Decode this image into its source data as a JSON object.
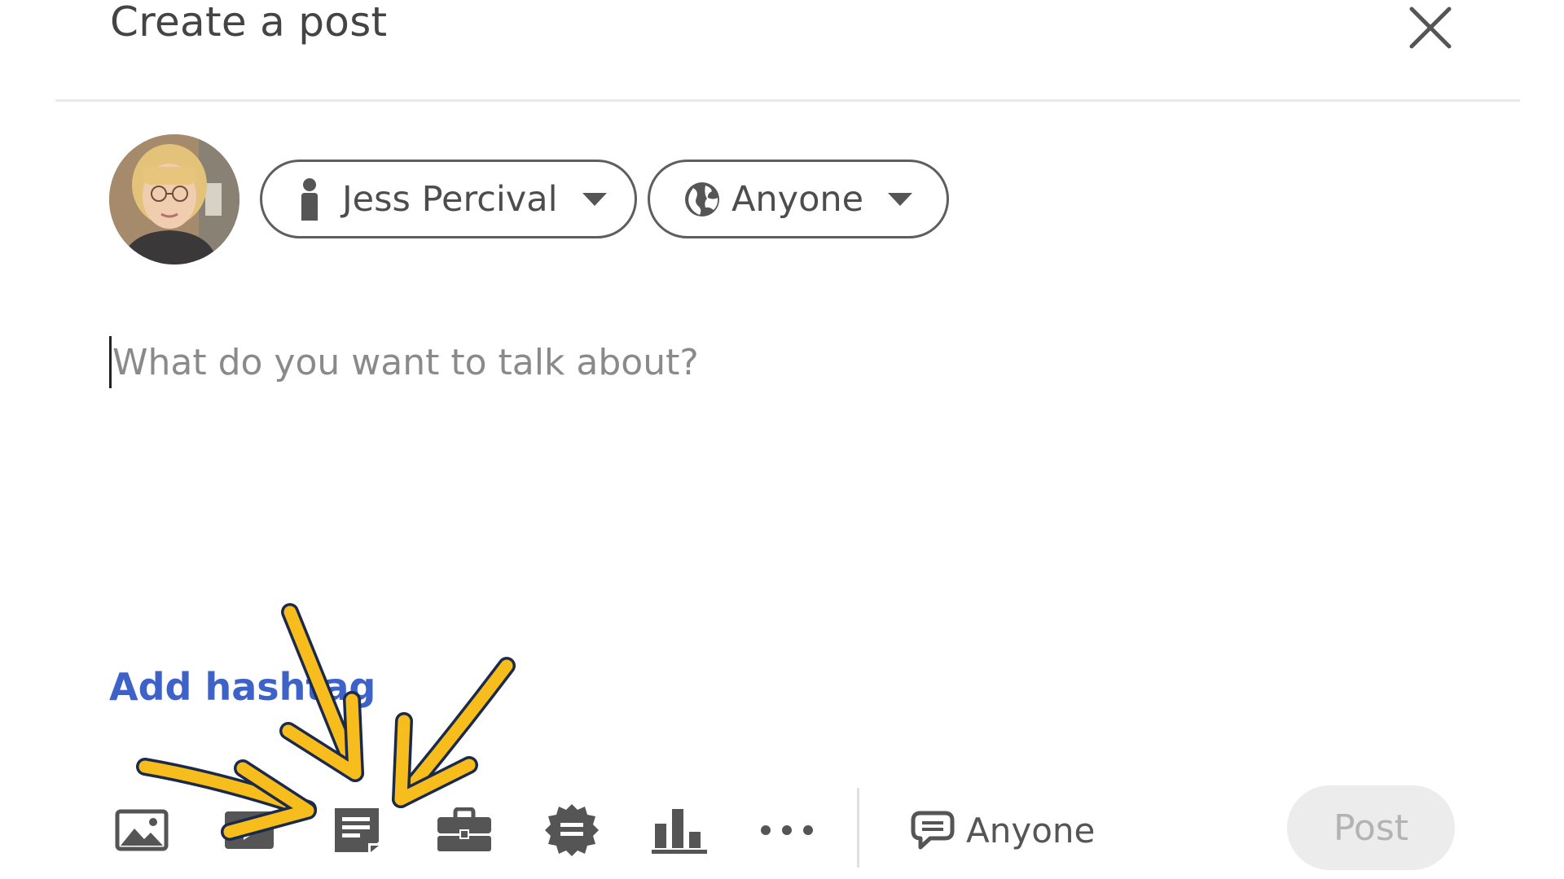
{
  "header": {
    "title": "Create a post",
    "close_icon": "close-icon"
  },
  "composer": {
    "author_name": "Jess Percival",
    "author_icon": "person-icon",
    "visibility_label": "Anyone",
    "visibility_icon": "globe-icon",
    "caret_icon": "caret-down-icon",
    "placeholder": "What do you want to talk about?",
    "hashtag_label": "Add hashtag"
  },
  "toolbar": {
    "tools": [
      {
        "name": "Add a photo",
        "icon": "photo-icon"
      },
      {
        "name": "Add a video",
        "icon": "video-icon"
      },
      {
        "name": "Add a document",
        "icon": "document-icon"
      },
      {
        "name": "Share that you're hiring",
        "icon": "briefcase-icon"
      },
      {
        "name": "Celebrate an occasion",
        "icon": "badge-icon"
      },
      {
        "name": "Create a poll",
        "icon": "poll-icon"
      },
      {
        "name": "More",
        "icon": "more-icon"
      }
    ],
    "comment_icon": "comment-icon",
    "comment_visibility": "Anyone",
    "post_label": "Post",
    "post_enabled": false
  },
  "annotation": {
    "arrow_count": 3,
    "arrow_color": "#f7bd1c",
    "outline_color": "#1b2a4a"
  },
  "colors": {
    "link": "#3d63c9",
    "icon": "#555555",
    "disabled_button_bg": "#ececec",
    "disabled_button_text": "#b3b3b3"
  }
}
